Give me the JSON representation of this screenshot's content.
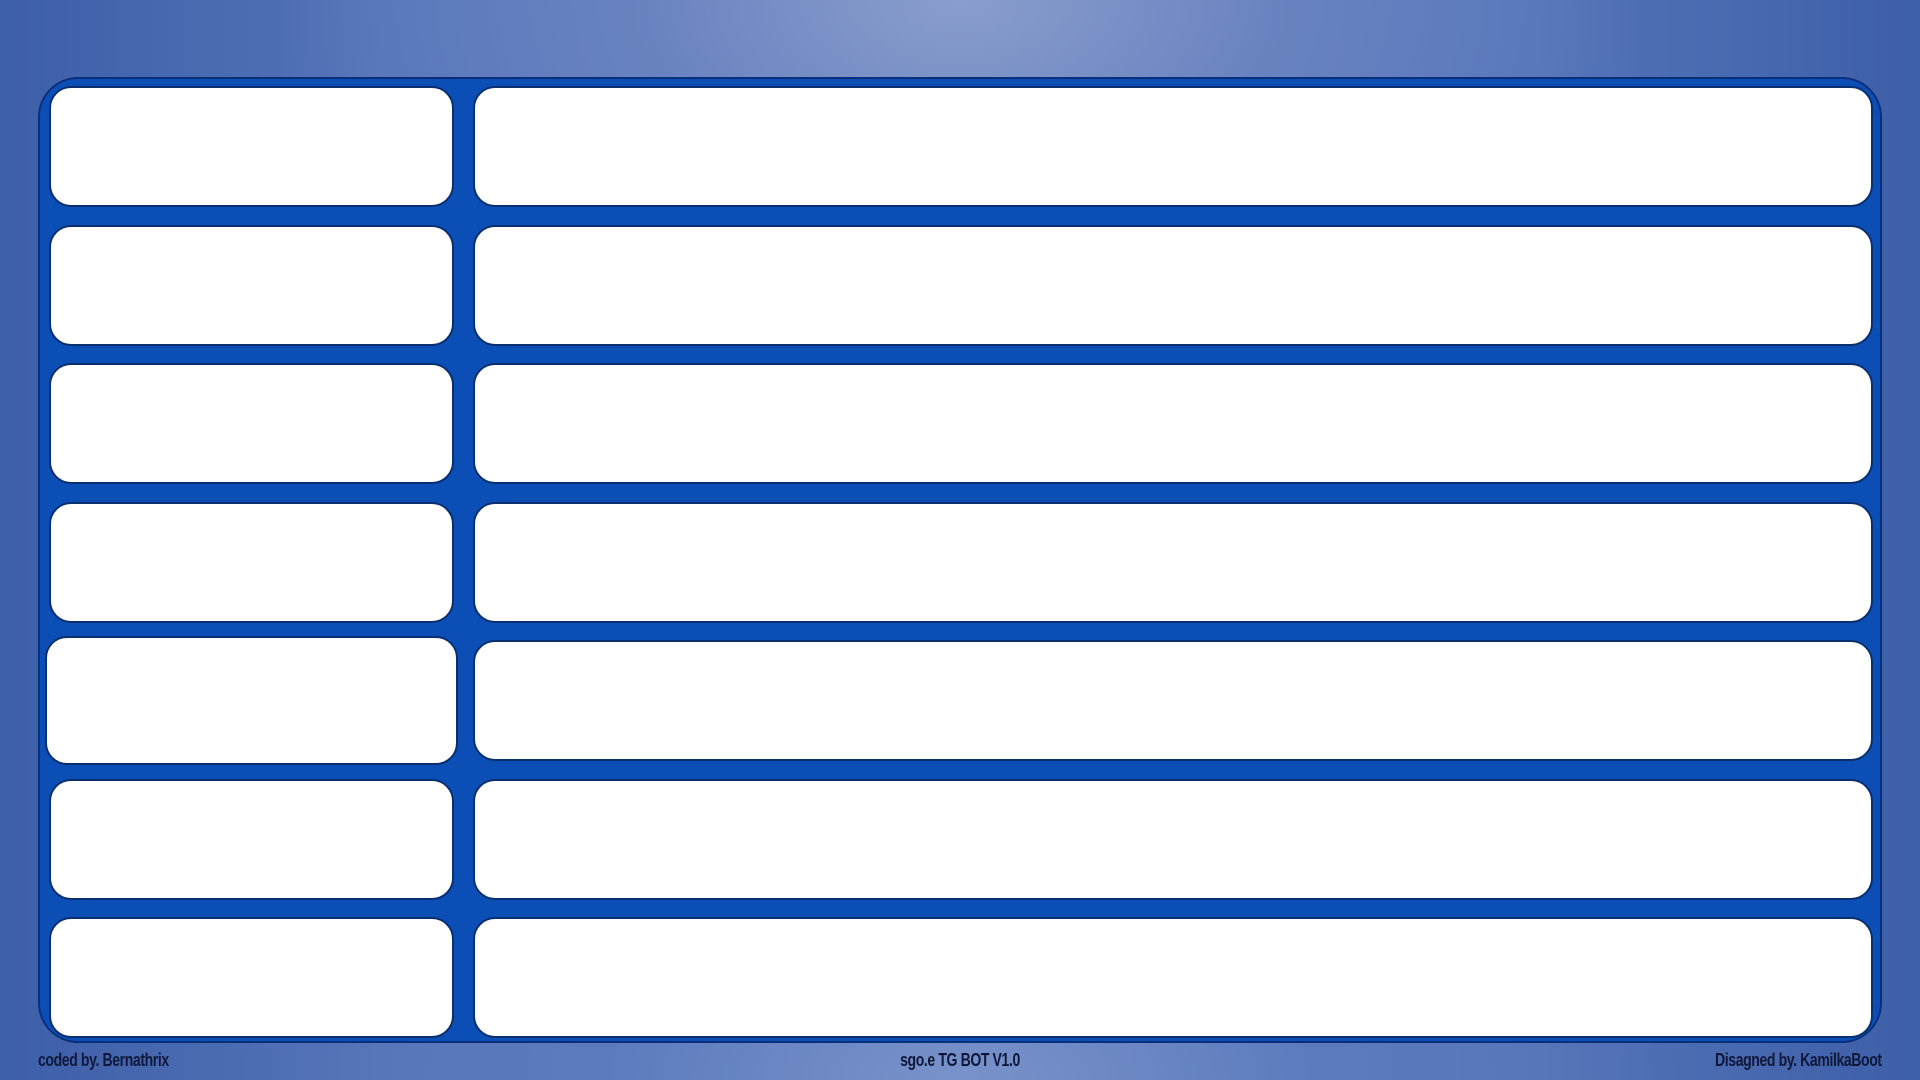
{
  "footer": {
    "left_text": "coded by. Bernathrix",
    "center_text": "sgo.e TG BOT V1.0",
    "right_text": "Disagned by. KamilkaBoot"
  },
  "colors": {
    "background": "#5f7cbd",
    "board": "#0b4fb6",
    "board_border": "#0a2f7a",
    "cell": "#ffffff",
    "footer_text": "#10183a"
  },
  "grid": {
    "rows": [
      {
        "left": "",
        "right": ""
      },
      {
        "left": "",
        "right": ""
      },
      {
        "left": "",
        "right": ""
      },
      {
        "left": "",
        "right": ""
      },
      {
        "left": "",
        "right": ""
      },
      {
        "left": "",
        "right": ""
      },
      {
        "left": "",
        "right": ""
      }
    ]
  }
}
